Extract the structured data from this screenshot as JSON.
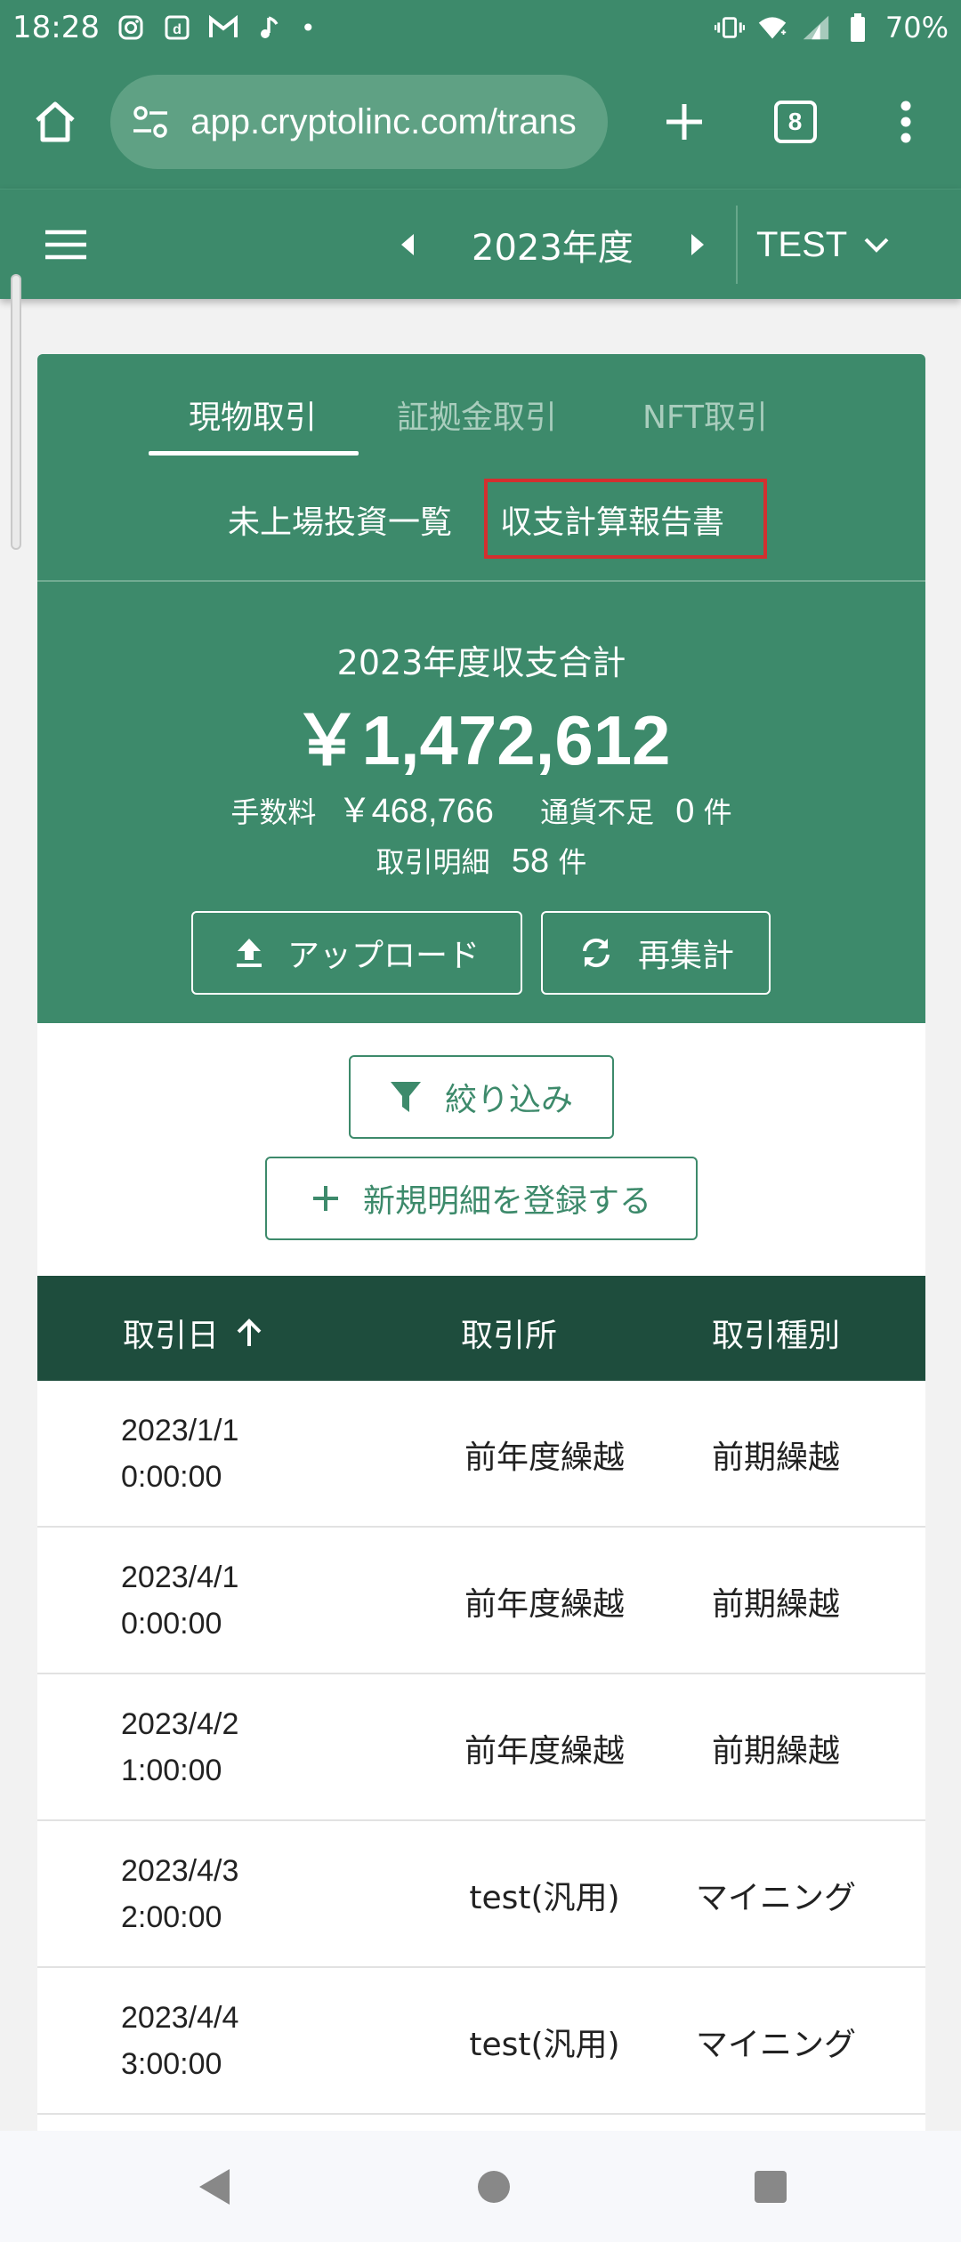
{
  "status_bar": {
    "time": "18:28",
    "battery": "70%",
    "dot": "•"
  },
  "browser": {
    "url": "app.cryptolinc.com/trans",
    "tab_count": "8"
  },
  "app_header": {
    "year": "2023年度",
    "account": "TEST"
  },
  "tabs": [
    {
      "label": "現物取引"
    },
    {
      "label": "証拠金取引"
    },
    {
      "label": "NFT取引"
    }
  ],
  "sub_links": [
    {
      "label": "未上場投資一覧"
    },
    {
      "label": "収支計算報告書"
    }
  ],
  "summary": {
    "title": "2023年度収支合計",
    "total": "￥1,472,612",
    "fee_label": "手数料",
    "fee_value": "￥468,766",
    "shortage_label": "通貨不足",
    "shortage_value": "0",
    "shortage_unit": "件",
    "details_label": "取引明細",
    "details_value": "58",
    "details_unit": "件"
  },
  "actions": {
    "upload": "アップロード",
    "recalc": "再集計",
    "filter": "絞り込み",
    "new_entry": "新規明細を登録する"
  },
  "table": {
    "headers": [
      "取引日",
      "取引所",
      "取引種別"
    ],
    "rows": [
      {
        "date": "2023/1/1",
        "time": "0:00:00",
        "exchange": "前年度繰越",
        "type": "前期繰越"
      },
      {
        "date": "2023/4/1",
        "time": "0:00:00",
        "exchange": "前年度繰越",
        "type": "前期繰越"
      },
      {
        "date": "2023/4/2",
        "time": "1:00:00",
        "exchange": "前年度繰越",
        "type": "前期繰越"
      },
      {
        "date": "2023/4/3",
        "time": "2:00:00",
        "exchange": "test(汎用)",
        "type": "マイニング"
      },
      {
        "date": "2023/4/4",
        "time": "3:00:00",
        "exchange": "test(汎用)",
        "type": "マイニング"
      }
    ]
  },
  "colors": {
    "primary": "#3d8a6b",
    "table_header": "#1e4d3d",
    "highlight": "#d32f2f"
  }
}
